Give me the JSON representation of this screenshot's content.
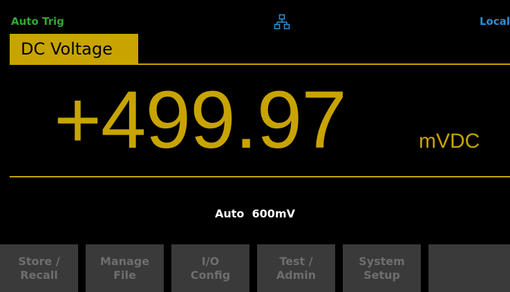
{
  "status": {
    "trigger_mode": "Auto Trig",
    "network_icon": "lan-icon",
    "remote_state": "Local"
  },
  "measurement": {
    "function": "DC Voltage",
    "value": "+499.97",
    "unit": "mVDC",
    "range": "Auto  600mV"
  },
  "softkeys": [
    {
      "line1": "Store /",
      "line2": "Recall"
    },
    {
      "line1": "Manage",
      "line2": "File"
    },
    {
      "line1": "I/O",
      "line2": "Config"
    },
    {
      "line1": "Test /",
      "line2": "Admin"
    },
    {
      "line1": "System",
      "line2": "Setup"
    },
    {
      "line1": "",
      "line2": ""
    }
  ],
  "colors": {
    "accent": "#c8a400",
    "trigger": "#2faa2f",
    "remote": "#2a8fd6",
    "softkey_bg": "#3a3a3a",
    "softkey_text": "#6e6e6e"
  }
}
